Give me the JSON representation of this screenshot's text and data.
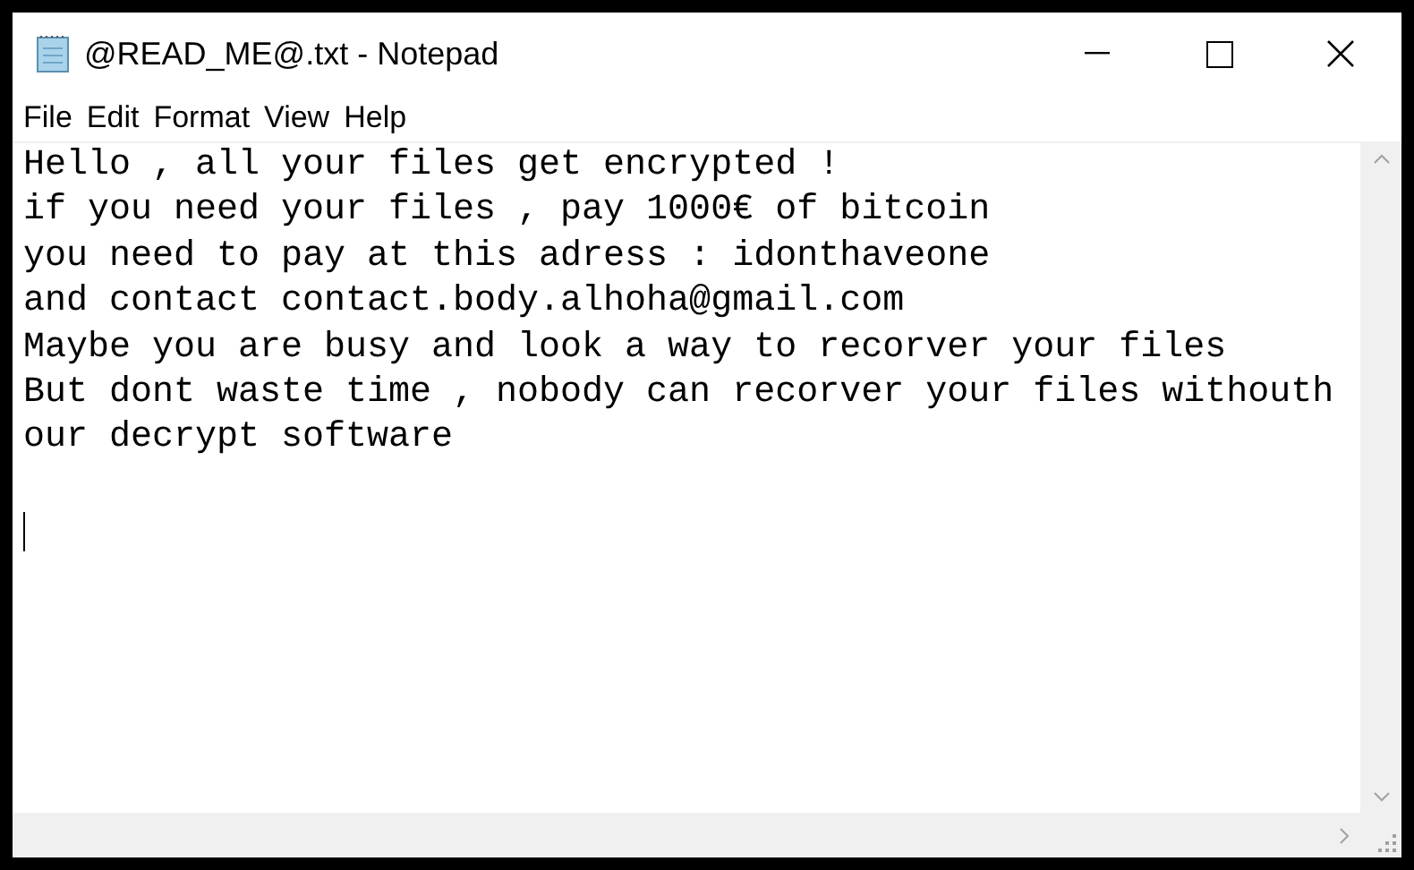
{
  "window": {
    "title": "@READ_ME@.txt - Notepad"
  },
  "menu": [
    "File",
    "Edit",
    "Format",
    "View",
    "Help"
  ],
  "document": {
    "lines": [
      "Hello , all your files get encrypted !",
      "if you need your files , pay 1000€ of bitcoin",
      "you need to pay at this adress : idonthaveone",
      "and contact contact.body.alhoha@gmail.com",
      "Maybe you are busy and look a way to recorver your files",
      "But dont waste time , nobody can recorver your files withouth",
      "our decrypt software"
    ]
  }
}
